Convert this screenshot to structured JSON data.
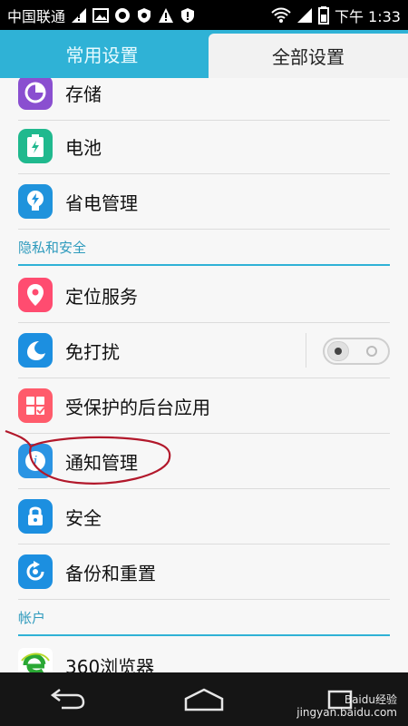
{
  "statusbar": {
    "carrier": "中国联通",
    "time": "下午 1:33"
  },
  "tabs": {
    "common": "常用设置",
    "all": "全部设置"
  },
  "list": {
    "items_top": [
      {
        "key": "storage",
        "label": "存储",
        "icon": "storage-icon",
        "color": "#8a4fd0"
      },
      {
        "key": "battery",
        "label": "电池",
        "icon": "battery-icon",
        "color": "#20b98e"
      },
      {
        "key": "power_saving",
        "label": "省电管理",
        "icon": "power-saving-icon",
        "color": "#1f93dc"
      }
    ],
    "section_privacy": "隐私和安全",
    "items_privacy": [
      {
        "key": "location",
        "label": "定位服务",
        "icon": "location-pin-icon",
        "color": "#ff4c70"
      },
      {
        "key": "dnd",
        "label": "免打扰",
        "icon": "moon-icon",
        "color": "#1c8fe0"
      },
      {
        "key": "protected_apps",
        "label": "受保护的后台应用",
        "icon": "protected-apps-icon",
        "color": "#ff5b6b"
      },
      {
        "key": "notifications",
        "label": "通知管理",
        "icon": "info-icon",
        "color": "#2b94e3"
      },
      {
        "key": "security",
        "label": "安全",
        "icon": "lock-icon",
        "color": "#1c8fe0"
      },
      {
        "key": "backup_reset",
        "label": "备份和重置",
        "icon": "backup-icon",
        "color": "#1c8fe0"
      }
    ],
    "section_accounts": "帐户",
    "items_accounts": [
      {
        "key": "browser_360",
        "label": "360浏览器",
        "icon": "browser-360-icon",
        "color": "#2aa834"
      }
    ]
  },
  "watermark": {
    "brand": "Baidu经验",
    "url": "jingyan.baidu.com"
  }
}
